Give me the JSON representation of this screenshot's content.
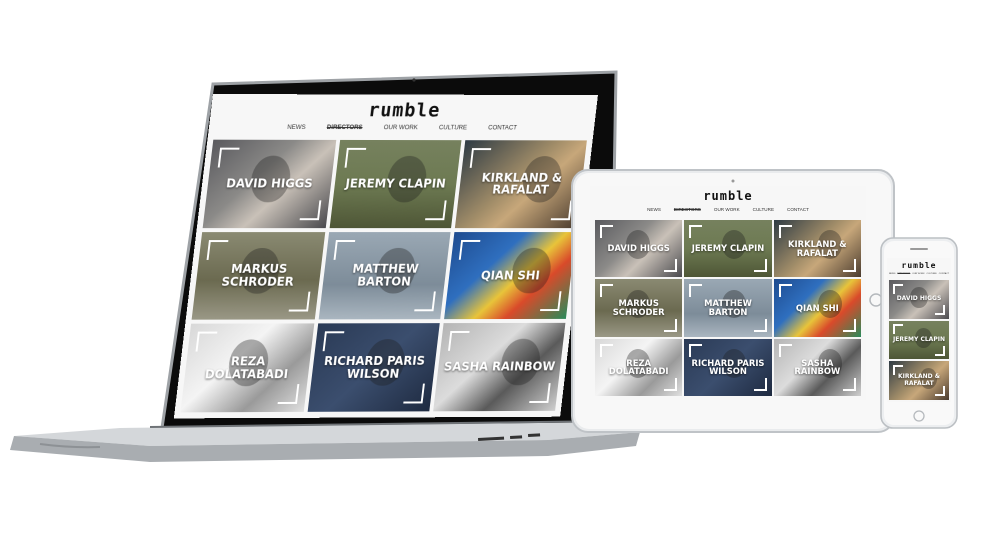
{
  "site": {
    "logo": "rumble",
    "nav": [
      "NEWS",
      "DIRECTORS",
      "OUR WORK",
      "CULTURE",
      "CONTACT"
    ],
    "active_nav": "DIRECTORS"
  },
  "directors": [
    {
      "name": "DAVID HIGGS"
    },
    {
      "name": "JEREMY CLAPIN"
    },
    {
      "name": "KIRKLAND & RAFALAT"
    },
    {
      "name": "MARKUS SCHRODER"
    },
    {
      "name": "MATTHEW BARTON"
    },
    {
      "name": "QIAN SHI"
    },
    {
      "name": "REZA DOLATABADI"
    },
    {
      "name": "RICHARD PARIS WILSON"
    },
    {
      "name": "SASHA RAINBOW"
    }
  ],
  "devices": {
    "laptop": "laptop",
    "tablet": "tablet",
    "phone": "phone"
  },
  "colors": {
    "background": "#ffffff",
    "device_silver": "#c9ccd0",
    "bezel_black": "#0b0b0b",
    "screen_bg": "#f7f7f7"
  }
}
